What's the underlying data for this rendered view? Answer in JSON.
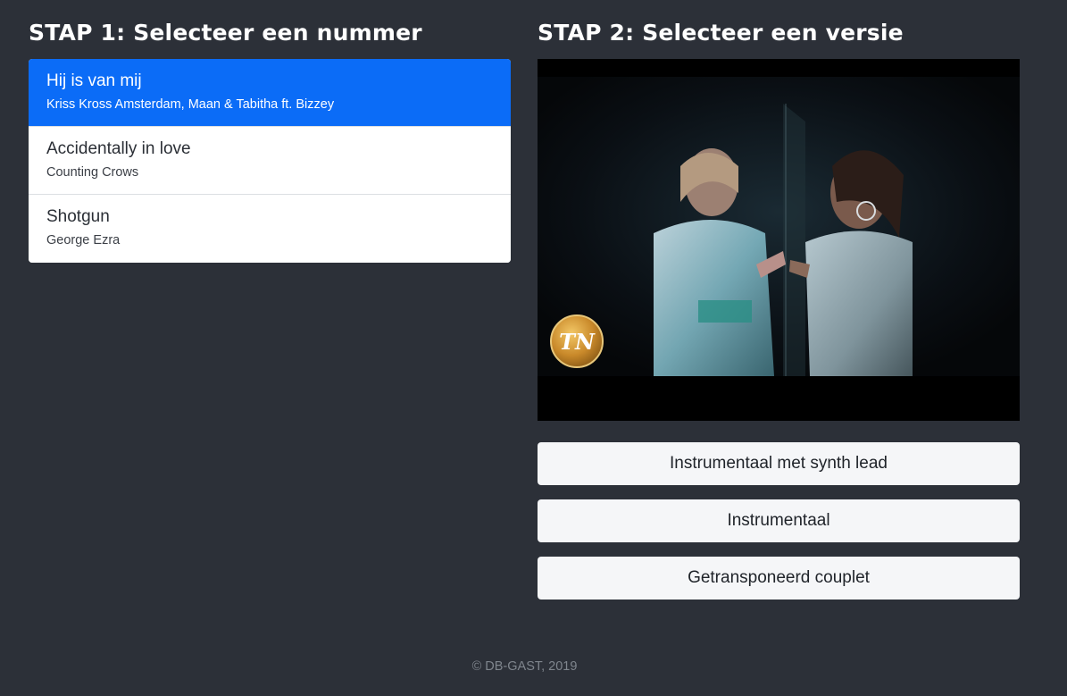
{
  "step1": {
    "title": "STAP 1: Selecteer een nummer",
    "songs": [
      {
        "title": "Hij is van mij",
        "artist": "Kriss Kross Amsterdam, Maan & Tabitha ft. Bizzey",
        "selected": true
      },
      {
        "title": "Accidentally in love",
        "artist": "Counting Crows",
        "selected": false
      },
      {
        "title": "Shotgun",
        "artist": "George Ezra",
        "selected": false
      }
    ]
  },
  "step2": {
    "title": "STAP 2: Selecteer een versie",
    "video_logo": "TN",
    "versions": [
      {
        "label": "Instrumentaal met synth lead"
      },
      {
        "label": "Instrumentaal"
      },
      {
        "label": "Getransponeerd couplet"
      }
    ]
  },
  "footer": {
    "text": "© DB-GAST, 2019"
  },
  "colors": {
    "background": "#2c3038",
    "accent": "#0b6cf7",
    "button": "#f5f6f8"
  }
}
